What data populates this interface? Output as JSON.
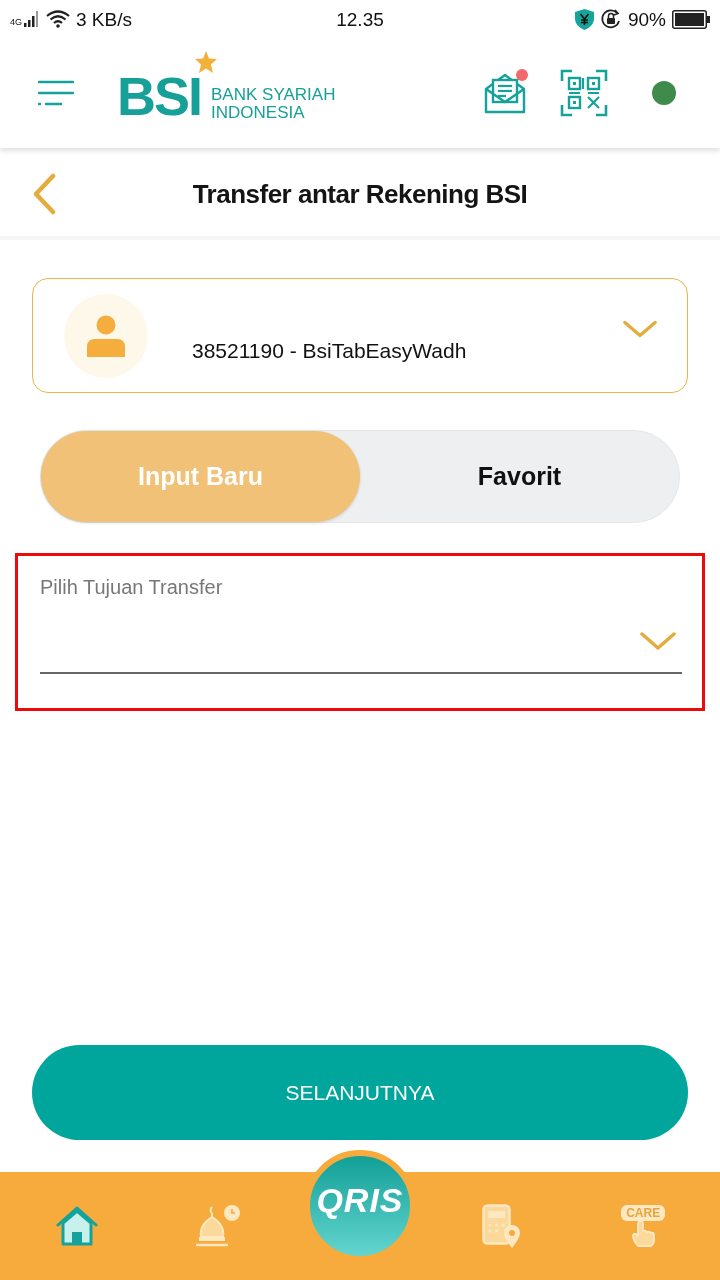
{
  "status_bar": {
    "network": "4G",
    "speed": "3 KB/s",
    "time": "12.35",
    "battery": "90%"
  },
  "header": {
    "logo": {
      "mark": "BSI",
      "line_1": "BANK SYARIAH",
      "line_2": "INDONESIA"
    },
    "mail_unread": true
  },
  "page": {
    "title": "Transfer antar Rekening BSI"
  },
  "source_account": {
    "value": "38521190 - BsiTabEasyWadh"
  },
  "tabs": [
    {
      "label": "Input Baru",
      "selected": true
    },
    {
      "label": "Favorit",
      "selected": false
    }
  ],
  "destination": {
    "placeholder": "Pilih Tujuan Transfer",
    "highlighted": true
  },
  "primary_button": {
    "label": "SELANJUTNYA"
  },
  "bottom_nav": [
    {
      "kind": "home",
      "selected": true
    },
    {
      "kind": "mosque",
      "selected": false
    },
    {
      "kind": "qris",
      "label": "QRIS",
      "selected": false
    },
    {
      "kind": "atm",
      "selected": false
    },
    {
      "kind": "care",
      "label": "CARE",
      "selected": false
    }
  ]
}
